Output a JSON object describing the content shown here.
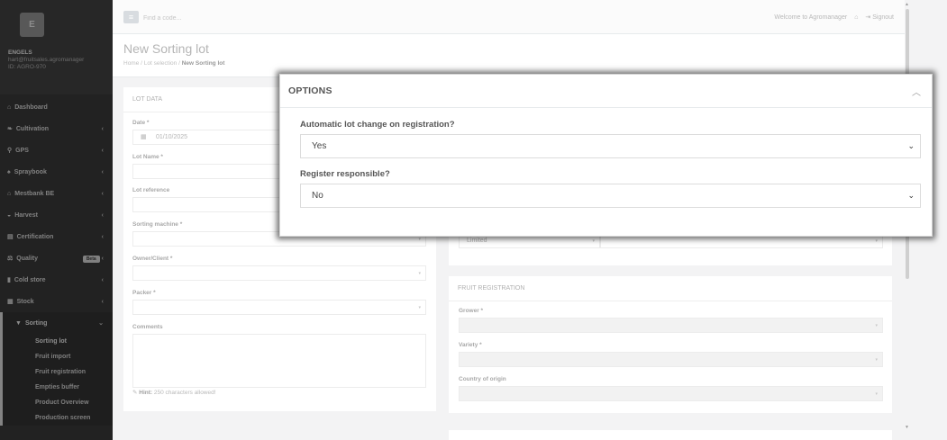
{
  "sidebar": {
    "avatar_letter": "E",
    "org": "ENGELS",
    "email": "hart@fruitsales.agromanager",
    "user_id": "ID: AGRO-970",
    "items": [
      {
        "icon": "home-icon",
        "glyph": "⌂",
        "label": "Dashboard",
        "chevron": ""
      },
      {
        "icon": "leaf-icon",
        "glyph": "❧",
        "label": "Cultivation",
        "chevron": "‹"
      },
      {
        "icon": "map-pin-icon",
        "glyph": "⚲",
        "label": "GPS",
        "chevron": "‹"
      },
      {
        "icon": "spray-icon",
        "glyph": "♠",
        "label": "Spraybook",
        "chevron": "‹"
      },
      {
        "icon": "bank-icon",
        "glyph": "⌂",
        "label": "Mestbank BE",
        "chevron": "‹"
      },
      {
        "icon": "harvest-icon",
        "glyph": "◒",
        "label": "Harvest",
        "chevron": "‹"
      },
      {
        "icon": "certificate-icon",
        "glyph": "▤",
        "label": "Certification",
        "chevron": "‹"
      },
      {
        "icon": "quality-icon",
        "glyph": "⚖",
        "label": "Quality",
        "chevron": "‹",
        "badge": "Beta"
      },
      {
        "icon": "thermometer-icon",
        "glyph": "▮",
        "label": "Cold store",
        "chevron": "‹"
      },
      {
        "icon": "stock-icon",
        "glyph": "▦",
        "label": "Stock",
        "chevron": "‹"
      }
    ],
    "active_item": {
      "icon": "filter-icon",
      "glyph": "▼",
      "label": "Sorting",
      "chevron": "⌄"
    },
    "sub_items": [
      "Sorting lot",
      "Fruit import",
      "Fruit registration",
      "Empties buffer",
      "Product Overview",
      "Production screen"
    ]
  },
  "topbar": {
    "search_placeholder": "Find a code...",
    "welcome": "Welcome to Agromanager",
    "signout": "Signout"
  },
  "heading": {
    "title": "New Sorting lot",
    "breadcrumb": [
      "Home",
      "Lot selection",
      "New Sorting lot"
    ]
  },
  "lot_data": {
    "title": "LOT DATA",
    "date_label": "Date *",
    "date_value": "01/10/2025",
    "lot_name_label": "Lot Name *",
    "lot_reference_label": "Lot reference",
    "sorting_machine_label": "Sorting machine *",
    "owner_label": "Owner/Client *",
    "packer_label": "Packer *",
    "comments_label": "Comments",
    "hint_label": "Hint:",
    "hint_text": "250 characters allowed!"
  },
  "right_panel": {
    "limited_value": "Limited"
  },
  "fruit_registration": {
    "title": "FRUIT REGISTRATION",
    "grower_label": "Grower *",
    "variety_label": "Variety *",
    "country_label": "Country of origin"
  },
  "options_modal": {
    "title": "OPTIONS",
    "q1": "Automatic lot change on registration?",
    "q1_value": "Yes",
    "q2": "Register responsible?",
    "q2_value": "No"
  }
}
